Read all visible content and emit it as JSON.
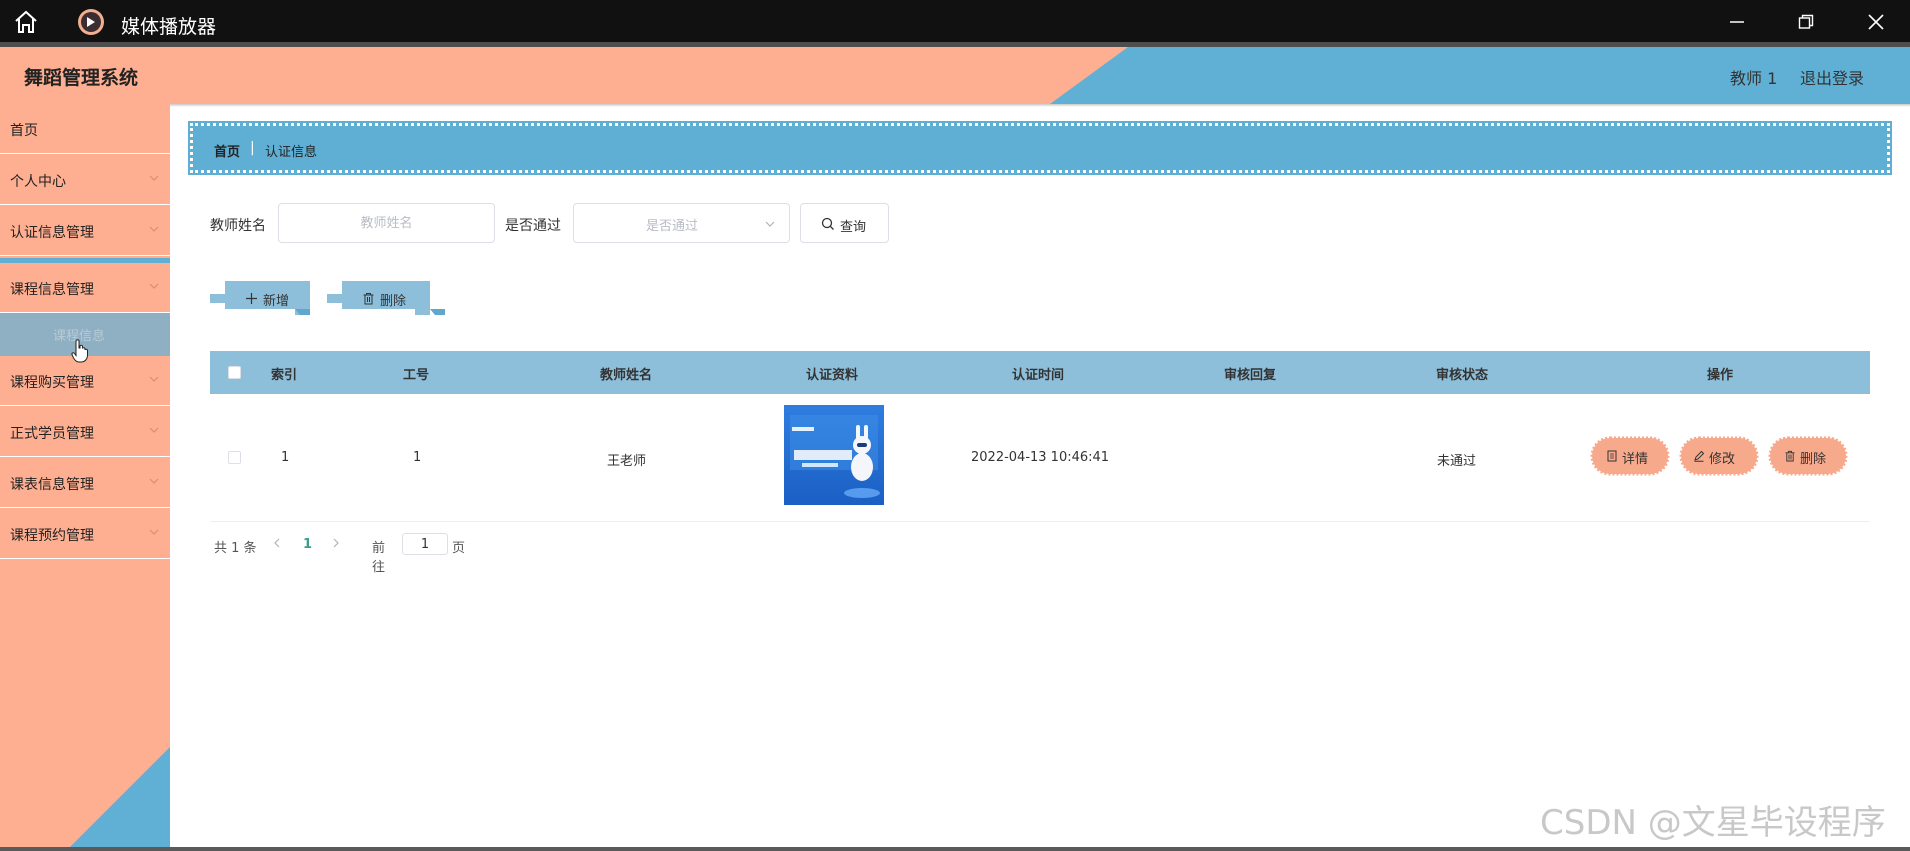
{
  "window": {
    "title": "媒体播放器",
    "home_icon": "home-icon",
    "app_icon": "play-circle-icon",
    "controls": [
      "minimize-icon",
      "restore-icon",
      "close-icon"
    ]
  },
  "header": {
    "system_title": "舞蹈管理系统",
    "user_label": "教师 1",
    "logout_label": "退出登录",
    "colors": {
      "salmon": "#ffaf91",
      "blue": "#5fb0d4"
    }
  },
  "sidebar": {
    "items": [
      {
        "label": "首页",
        "has_arrow": false
      },
      {
        "label": "个人中心",
        "has_arrow": true
      },
      {
        "label": "认证信息管理",
        "has_arrow": true
      },
      {
        "label": "课程信息管理",
        "has_arrow": true
      },
      {
        "label": "课程购买管理",
        "has_arrow": true
      },
      {
        "label": "正式学员管理",
        "has_arrow": true
      },
      {
        "label": "课表信息管理",
        "has_arrow": true
      },
      {
        "label": "课程预约管理",
        "has_arrow": true
      }
    ],
    "submenu_label": "课程信息"
  },
  "breadcrumb": {
    "home": "首页",
    "separator": "|",
    "current": "认证信息"
  },
  "search": {
    "name_label": "教师姓名",
    "name_placeholder": "教师姓名",
    "pass_label": "是否通过",
    "pass_placeholder": "是否通过",
    "query_label": "查询"
  },
  "actions": {
    "add_label": "新增",
    "delete_label": "删除"
  },
  "table": {
    "headers": [
      "索引",
      "工号",
      "教师姓名",
      "认证资料",
      "认证时间",
      "审核回复",
      "审核状态",
      "操作"
    ],
    "rows": [
      {
        "index": "1",
        "job_no": "1",
        "teacher_name": "王老师",
        "material_image": "certification-thumbnail",
        "time": "2022-04-13 10:46:41",
        "reply": "",
        "status": "未通过"
      }
    ],
    "row_actions": {
      "detail": "详情",
      "edit": "修改",
      "delete": "删除"
    }
  },
  "pagination": {
    "total": "共 1 条",
    "current_page": "1",
    "goto_label": "前往",
    "goto_value": "1",
    "page_unit": "页"
  },
  "watermark": "CSDN @文星毕设程序"
}
